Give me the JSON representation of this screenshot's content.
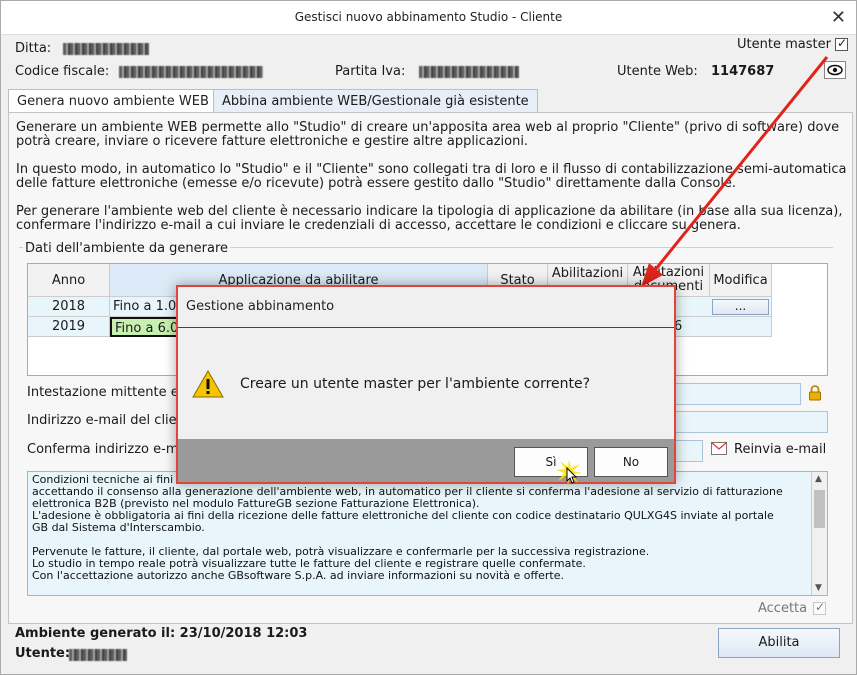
{
  "window": {
    "title": "Gestisci nuovo abbinamento Studio - Cliente",
    "close_glyph": "✕"
  },
  "header": {
    "ditta_label": "Ditta:",
    "codice_fiscale_label": "Codice fiscale:",
    "partita_iva_label": "Partita Iva:",
    "utente_master_label": "Utente master",
    "utente_web_label": "Utente Web:",
    "utente_web_value": "1147687"
  },
  "tabs": [
    {
      "label": "Genera nuovo ambiente WEB"
    },
    {
      "label": "Abbina ambiente WEB/Gestionale già esistente"
    }
  ],
  "intro": {
    "p1": "Generare un ambiente WEB permette allo \"Studio\" di creare un'apposita area web al proprio \"Cliente\" (privo di software) dove\npotrà creare, inviare o ricevere fatture elettroniche e gestire altre applicazioni.",
    "p2": "In questo modo, in automatico lo \"Studio\" e il \"Cliente\" sono collegati tra di loro e il flusso di contabilizzazione semi-automatica\ndelle fatture elettroniche (emesse e/o ricevute) potrà essere gestito dallo \"Studio\" direttamente dalla Console.",
    "p3": "Per generare l'ambiente web del cliente è necessario indicare la tipologia di applicazione da abilitare (in base alla sua licenza),\nconfermare l'indirizzo e-mail a cui inviare le credenziali di accesso, accettare le condizioni e cliccare su genera."
  },
  "group_title": "Dati dell'ambiente da generare",
  "grid": {
    "headers": {
      "anno": "Anno",
      "applicazione": "Applicazione da abilitare",
      "stato": "Stato",
      "abil1": "Abilitazioni",
      "abil2": "Abilitazioni",
      "abil2b": "documenti",
      "modifica": "Modifica"
    },
    "rows": [
      {
        "anno": "2018",
        "applicazione": "Fino a 1.0",
        "modifica": "..."
      },
      {
        "anno": "2019",
        "applicazione": "Fino a 6.0",
        "tail": "6"
      }
    ]
  },
  "fields": {
    "intestazione_label": "Intestazione mittente e",
    "email_label": "Indirizzo e-mail del clien",
    "conferma_label": "Conferma indirizzo e-ma",
    "reinvia_label": "Reinvia e-mail"
  },
  "conditions": {
    "text": "Condizioni tecniche ai fini\naccettando il consenso alla generazione dell'ambiente web, in automatico per il cliente si conferma l'adesione al servizio di fatturazione\nelettronica B2B (previsto nel modulo FattureGB sezione Fatturazione Elettronica).\nL'adesione è obbligatoria ai fini della ricezione delle fatture elettroniche del cliente con codice destinatario QULXG4S inviate al portale\nGB dal Sistema d'Interscambio.\n\nPervenute le fatture, il cliente, dal portale web, potrà visualizzare e confermarle per la successiva registrazione.\nLo studio in tempo reale potrà visualizzare tutte le fatture del cliente e registrare quelle confermate.\nCon l'accettazione autorizzo anche GBsoftware S.p.A. ad inviare informazioni su novità e offerte.",
    "accetta_label": "Accetta"
  },
  "footer": {
    "ambiente_label": "Ambiente generato il: 23/10/2018 12:03",
    "utente_label": "Utente:",
    "abilita_button": "Abilita"
  },
  "dialog": {
    "title": "Gestione abbinamento",
    "message": "Creare un utente master per l'ambiente corrente?",
    "yes_button": "Sì",
    "no_button": "No"
  },
  "colors": {
    "accent_red": "#e0453a",
    "field_bg": "#e8f6fb",
    "highlight_green": "#c8f0b0"
  }
}
